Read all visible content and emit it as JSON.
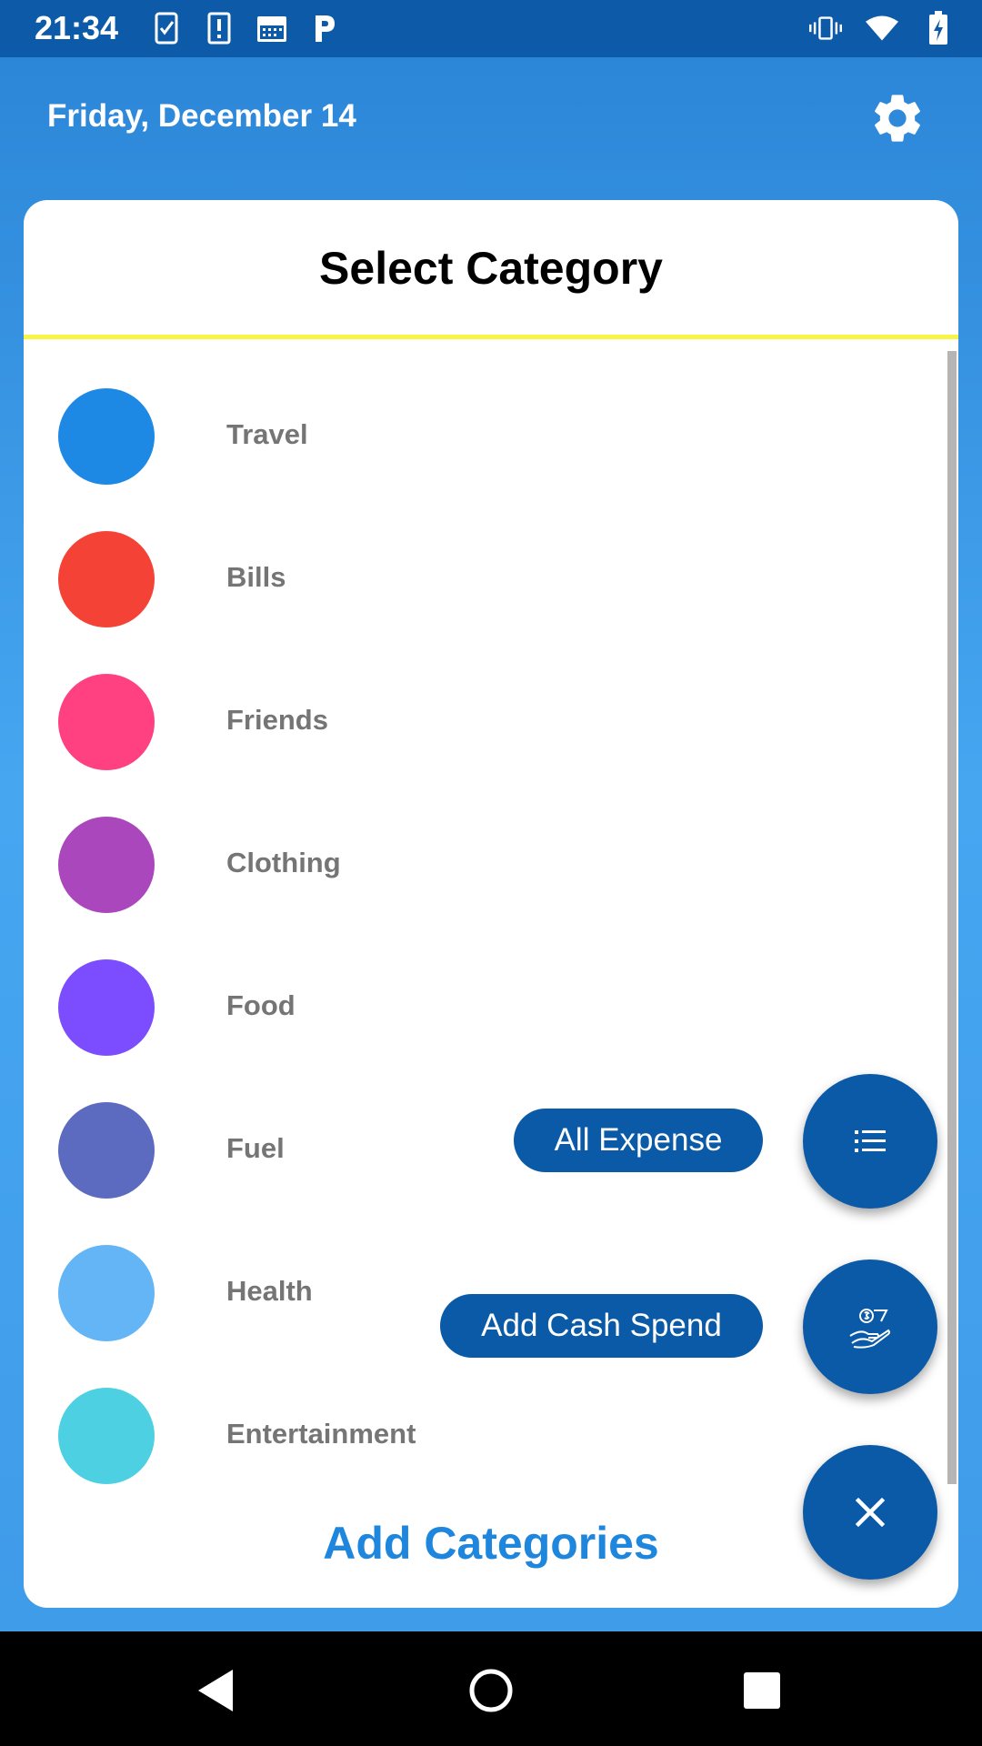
{
  "status_bar": {
    "time": "21:34",
    "left_icons": [
      "task-check-icon",
      "alert-icon",
      "calendar-icon",
      "parking-icon"
    ],
    "right_icons": [
      "vibrate-icon",
      "wifi-icon",
      "battery-charging-icon"
    ]
  },
  "header": {
    "date": "Friday, December 14",
    "settings_icon": "gear-icon"
  },
  "dialog": {
    "title": "Select Category",
    "divider_color": "#f8f545",
    "categories": [
      {
        "label": "Travel",
        "color": "#1e88e5"
      },
      {
        "label": "Bills",
        "color": "#f44336"
      },
      {
        "label": "Friends",
        "color": "#ff4081"
      },
      {
        "label": "Clothing",
        "color": "#ab47bc"
      },
      {
        "label": "Food",
        "color": "#7c4dff"
      },
      {
        "label": "Fuel",
        "color": "#5c6bc0"
      },
      {
        "label": "Health",
        "color": "#64b5f6"
      },
      {
        "label": "Entertainment",
        "color": "#4dd0e1"
      }
    ],
    "add_button": "Add Categories"
  },
  "fab_menu": {
    "all_expense_label": "All Expense",
    "all_expense_icon": "list-icon",
    "add_cash_label": "Add Cash Spend",
    "add_cash_icon": "cash-hand-icon",
    "close_icon": "close-icon",
    "accent": "#0a5aa8"
  },
  "nav_bar": {
    "back_icon": "back-icon",
    "home_icon": "home-icon",
    "recents_icon": "recents-icon"
  }
}
